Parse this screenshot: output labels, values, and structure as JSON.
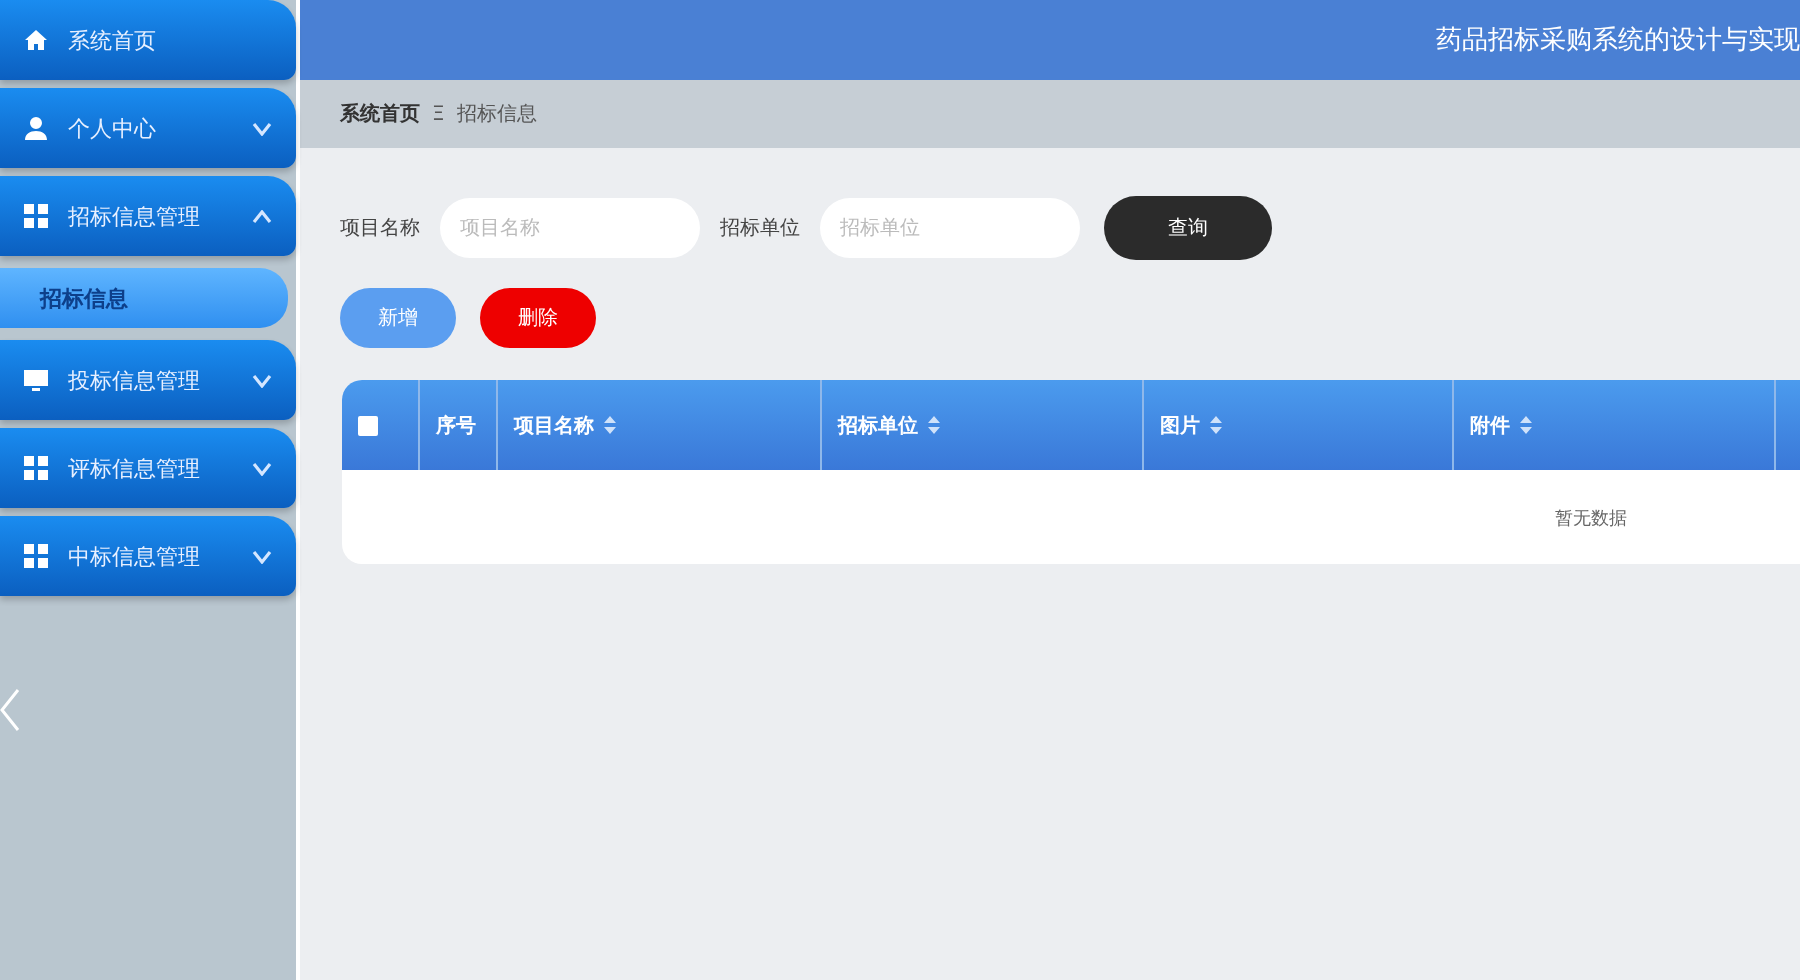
{
  "header": {
    "title": "药品招标采购系统的设计与实现"
  },
  "sidebar": {
    "items": [
      {
        "label": "系统首页",
        "kind": "home"
      },
      {
        "label": "个人中心",
        "kind": "profile",
        "expanded": false
      },
      {
        "label": "招标信息管理",
        "kind": "module",
        "expanded": true,
        "children": [
          {
            "label": "招标信息",
            "selected": true
          }
        ]
      },
      {
        "label": "投标信息管理",
        "kind": "screen",
        "expanded": false
      },
      {
        "label": "评标信息管理",
        "kind": "module",
        "expanded": false
      },
      {
        "label": "中标信息管理",
        "kind": "module",
        "expanded": false
      }
    ]
  },
  "breadcrumb": [
    {
      "label": "系统首页"
    },
    {
      "label": "招标信息"
    }
  ],
  "breadcrumb_separator": "Ξ",
  "search": {
    "fields": [
      {
        "label": "项目名称",
        "placeholder": "项目名称"
      },
      {
        "label": "招标单位",
        "placeholder": "招标单位"
      }
    ],
    "button": "查询"
  },
  "actions": [
    {
      "label": "新增",
      "kind": "add"
    },
    {
      "label": "删除",
      "kind": "delete"
    }
  ],
  "table": {
    "select_all_checked": false,
    "columns": [
      {
        "label": "序号",
        "sortable": false
      },
      {
        "label": "项目名称",
        "sortable": true
      },
      {
        "label": "招标单位",
        "sortable": true
      },
      {
        "label": "图片",
        "sortable": true
      },
      {
        "label": "附件",
        "sortable": true
      }
    ],
    "empty_text": "暂无数据"
  }
}
